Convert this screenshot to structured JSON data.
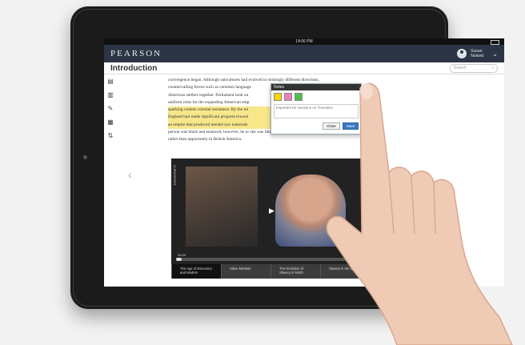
{
  "status_bar": {
    "time": "14:06 PM"
  },
  "header": {
    "logo": "PEARSON",
    "user_first": "Susan",
    "user_last": "Noland",
    "chevron": "⌄"
  },
  "page": {
    "title": "Introduction",
    "search_placeholder": "Search"
  },
  "toolbar": [
    {
      "name": "document-icon",
      "glyph": "▤"
    },
    {
      "name": "chart-icon",
      "glyph": "▥"
    },
    {
      "name": "pencil-icon",
      "glyph": "✎"
    },
    {
      "name": "book-icon",
      "glyph": "▦"
    },
    {
      "name": "sort-icon",
      "glyph": "⇅"
    }
  ],
  "nav": {
    "back": "‹"
  },
  "reading": {
    "lines": [
      "convergence began. Although subcultures had evolved in strikingly different directions,",
      "countervailing forces such as common language",
      "American settlers together. Parliament took on",
      "uniform roles for the expanding American emp",
      "sparking violent colonial resistance. By the mi",
      "England had made significant progress toward",
      "an empire that produced needed raw materials",
      "person was black and enslaved, however, he or she was likely to experience oppression",
      "rather than opportunity in British America."
    ]
  },
  "notes": {
    "title": "Notes",
    "text": "Important for Sections on Transition",
    "close": "Close",
    "save": "Save",
    "swatch_colors": [
      "#f3d600",
      "#e87fc0",
      "#4cc04c"
    ]
  },
  "video": {
    "side_label": "CURIOSITIES",
    "play": "▶",
    "time_start": "00:00",
    "time_end": "00:00",
    "progress": 0.03,
    "chapters": [
      "The Age of Discovery and Modern",
      "Slave Markets",
      "The Evolution of Slavery in North",
      "Slavery in the Colonies"
    ]
  }
}
